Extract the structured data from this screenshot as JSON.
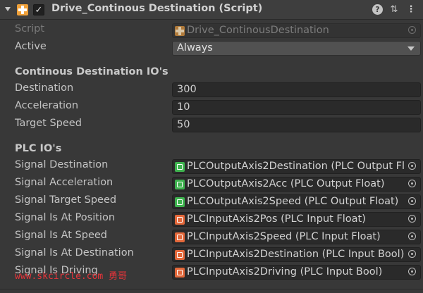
{
  "header": {
    "title": "Drive_Continous Destination (Script)",
    "enabled": true,
    "icons": [
      "component-icon",
      "help-icon",
      "preset-icon",
      "more-icon"
    ]
  },
  "script_row": {
    "label": "Script",
    "value": "Drive_ContinousDestination"
  },
  "active_row": {
    "label": "Active",
    "value": "Always"
  },
  "section_io": {
    "title": "Continous Destination IO's"
  },
  "fields": [
    {
      "label": "Destination",
      "value": "300"
    },
    {
      "label": "Acceleration",
      "value": "10"
    },
    {
      "label": "Target Speed",
      "value": "50"
    }
  ],
  "section_plc": {
    "title": "PLC IO's"
  },
  "signals": [
    {
      "label": "Signal Destination",
      "value": "PLCOutputAxis2Destination (PLC Output Fl",
      "kind": "output"
    },
    {
      "label": "Signal Acceleration",
      "value": "PLCOutputAxis2Acc (PLC Output Float)",
      "kind": "output"
    },
    {
      "label": "Signal Target Speed",
      "value": "PLCOutputAxis2Speed (PLC Output Float)",
      "kind": "output"
    },
    {
      "label": "Signal Is At Position",
      "value": "PLCInputAxis2Pos (PLC Input Float)",
      "kind": "input"
    },
    {
      "label": "Signal Is At Speed",
      "value": "PLCInputAxis2Speed (PLC Input Float)",
      "kind": "input"
    },
    {
      "label": "Signal Is At Destination",
      "value": "PLCInputAxis2Destination (PLC Input Bool)",
      "kind": "input"
    },
    {
      "label": "Signal Is Driving",
      "value": "PLCInputAxis2Driving (PLC Input Bool)",
      "kind": "input"
    }
  ],
  "watermark": "www.skcircle.com 勇哥",
  "colors": {
    "output_icon": "#3fb34f",
    "input_icon": "#e3683a",
    "component_icon": "#f0a13a",
    "watermark": "#e8343a"
  }
}
